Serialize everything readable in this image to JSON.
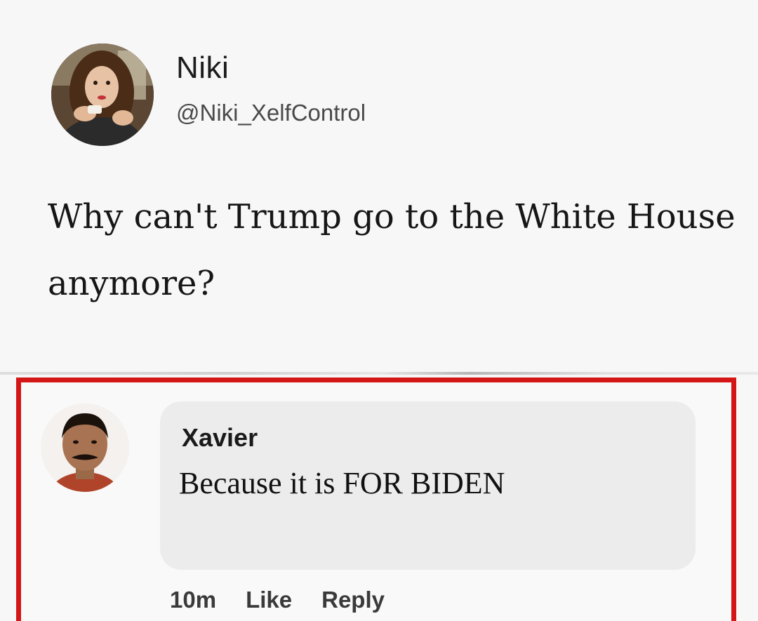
{
  "tweet": {
    "author_name": "Niki",
    "author_handle": "@Niki_XelfControl",
    "text": "Why can't Trump go to the White House anymore?",
    "avatar_icon": "profile-photo-woman"
  },
  "comment": {
    "author_name": "Xavier",
    "text": "Because it is FOR BIDEN",
    "timestamp": "10m",
    "like_label": "Like",
    "reply_label": "Reply",
    "avatar_icon": "profile-photo-man"
  },
  "colors": {
    "highlight_border": "#d41616",
    "comment_bubble": "#ececed",
    "background": "#f7f7f8"
  }
}
